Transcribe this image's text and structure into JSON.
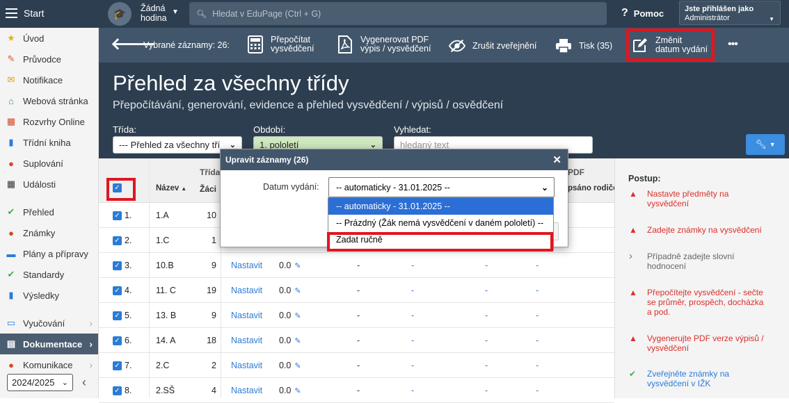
{
  "topbar": {
    "start_label": "Start",
    "hour_label": "Žádná\nhodina",
    "search_placeholder": "Hledat v EduPage (Ctrl + G)",
    "help_label": "Pomoc",
    "logged_in_label": "Jste přihlášen jako",
    "user_role": "Administrátor"
  },
  "sidebar": {
    "items": [
      {
        "label": "Úvod",
        "icon": "star-icon",
        "color": "#e8b400"
      },
      {
        "label": "Průvodce",
        "icon": "wand-icon",
        "color": "#e05a2b"
      },
      {
        "label": "Notifikace",
        "icon": "envelope-icon",
        "color": "#e6a000"
      },
      {
        "label": "Webová stránka",
        "icon": "home-icon",
        "color": "#2e9b48"
      },
      {
        "label": "Rozvrhy Online",
        "icon": "calendar-grid-icon",
        "color": "#d9452b"
      },
      {
        "label": "Třídní kniha",
        "icon": "book-icon",
        "color": "#2b7bd6"
      },
      {
        "label": "Suplování",
        "icon": "person-icon",
        "color": "#d9452b"
      },
      {
        "label": "Události",
        "icon": "calendar-icon",
        "color": "#333333"
      },
      {
        "label": "Přehled",
        "icon": "check-circle-icon",
        "color": "#3fae49"
      },
      {
        "label": "Známky",
        "icon": "grade-icon",
        "color": "#d9452b"
      },
      {
        "label": "Plány a přípravy",
        "icon": "briefcase-icon",
        "color": "#2b7bd6"
      },
      {
        "label": "Standardy",
        "icon": "shield-check-icon",
        "color": "#3fae49"
      },
      {
        "label": "Výsledky",
        "icon": "bar-chart-icon",
        "color": "#2b7bd6"
      },
      {
        "label": "Vyučování",
        "icon": "classroom-icon",
        "color": "#2b7bd6"
      },
      {
        "label": "Dokumentace",
        "icon": "document-icon",
        "color": "#ffffff"
      },
      {
        "label": "Komunikace",
        "icon": "chat-icon",
        "color": "#d9452b"
      }
    ],
    "year_select": "2024/2025",
    "collapse_icon": "chevron-left-icon"
  },
  "toolbar": {
    "selected_label": "Vybrané záznamy: 26:",
    "recalc_label": "Přepočítat\nvysvědčení",
    "pdf_label": "Vygenerovat PDF\nvýpis / vysvědčení",
    "unpublish_label": "Zrušit zveřejnění",
    "print_label": "Tisk (35)",
    "change_date_label": "Změnit\ndatum vydání",
    "more_label": "•••"
  },
  "header": {
    "title": "Přehled za všechny třídy",
    "subtitle": "Přepočítávání, generování, evidence a přehled vysvědčení / výpisů / osvědčení",
    "class_label": "Třída:",
    "class_value": "--- Přehled za všechny tří",
    "period_label": "Období:",
    "period_value": "1. pololetí",
    "search_label": "Vyhledat:",
    "search_placeholder": "hledaný text"
  },
  "table": {
    "group_header_class": "Třída",
    "group_header_pdf": "PDF",
    "col_name": "Název",
    "col_students": "Žáci",
    "col_signed": "psáno rodiče",
    "nastavit_label": "Nastavit",
    "rows": [
      {
        "n": "1.",
        "name": "1.A",
        "students": "10"
      },
      {
        "n": "2.",
        "name": "1.C",
        "students": "1"
      },
      {
        "n": "3.",
        "name": "10.B",
        "students": "9",
        "value": "0.0"
      },
      {
        "n": "4.",
        "name": "11. C",
        "students": "19",
        "value": "0.0"
      },
      {
        "n": "5.",
        "name": "13. B",
        "students": "9",
        "value": "0.0"
      },
      {
        "n": "6.",
        "name": "14. A",
        "students": "18",
        "value": "0.0"
      },
      {
        "n": "7.",
        "name": "2.C",
        "students": "2",
        "value": "0.0"
      },
      {
        "n": "8.",
        "name": "2.SŠ",
        "students": "4",
        "value": "0.0"
      }
    ]
  },
  "procedure": {
    "title": "Postup:",
    "steps": [
      {
        "text": "Nastavte předměty na vysvědčení",
        "status": "warning",
        "color": "#d9302b"
      },
      {
        "text": "Zadejte známky na vysvědčení",
        "status": "warning",
        "color": "#d9302b"
      },
      {
        "text": "Případně zadejte slovní hodnocení",
        "status": "optional",
        "color": "#666666"
      },
      {
        "text": "Přepočítejte vysvědčení - sečte se průměr, prospěch, docházka a pod.",
        "status": "warning",
        "color": "#d9302b"
      },
      {
        "text": "Vygenerujte PDF verze výpisů / vysvědčení",
        "status": "warning",
        "color": "#d9302b"
      },
      {
        "text": "Zveřejněte známky na vysvědčení v IŽK",
        "status": "done",
        "color": "#2b7bd6"
      }
    ]
  },
  "dialog": {
    "title": "Upravit záznamy (26)",
    "date_label": "Datum vydání:",
    "date_value": "-- automaticky - 31.01.2025 --",
    "options": [
      "-- automaticky - 31.01.2025 --",
      "-- Prázdný (Žák nemá vysvědčení v daném pololetí) --",
      "Zadat ručně"
    ]
  },
  "colors": {
    "header_bg": "#2d3e50",
    "toolbar_bg": "#42566b",
    "accent_blue": "#2b7bd6",
    "highlight_red": "#e0161f"
  }
}
